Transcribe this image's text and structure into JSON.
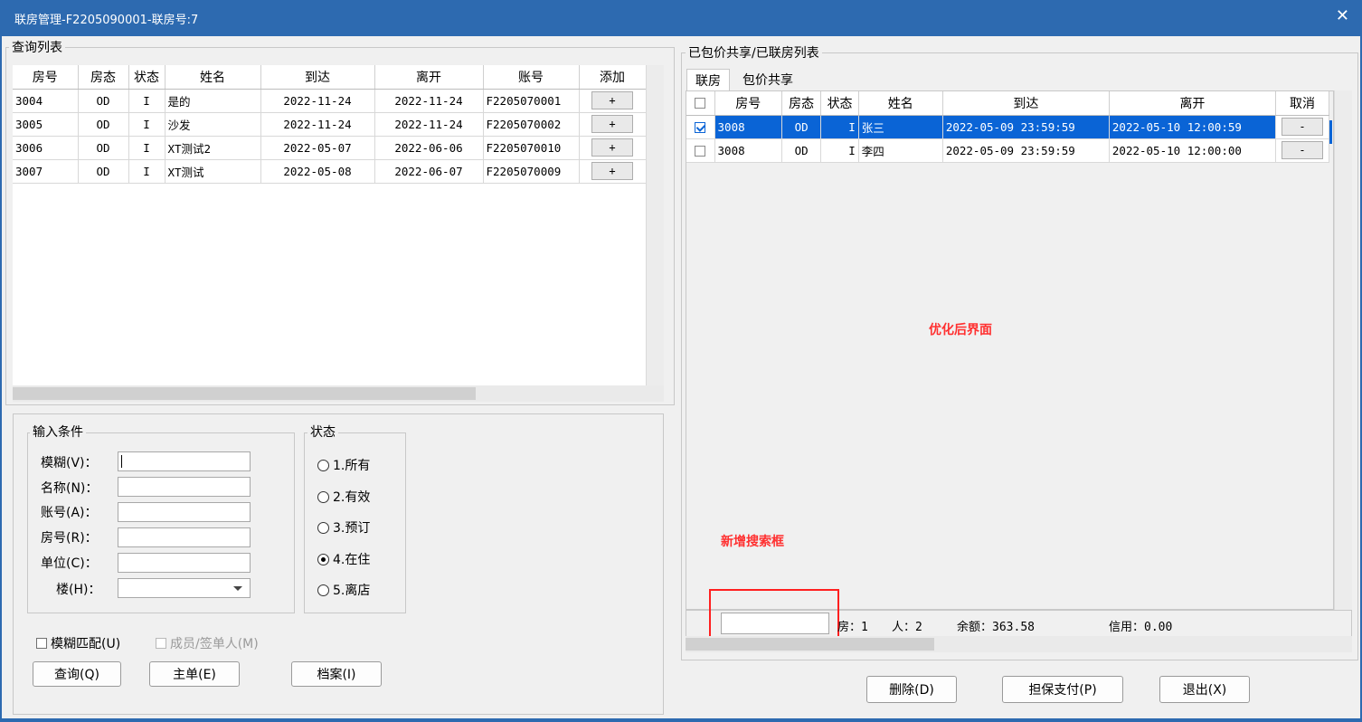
{
  "window": {
    "title": "联房管理-F2205090001-联房号:7",
    "close": "✕"
  },
  "left": {
    "group_title": "查询列表",
    "columns": [
      "房号",
      "房态",
      "状态",
      "姓名",
      "到达",
      "离开",
      "账号",
      "添加"
    ],
    "rows": [
      {
        "room": "3004",
        "room_state": "OD",
        "status": "I",
        "name": "是的",
        "arrive": "2022-11-24",
        "depart": "2022-11-24",
        "account": "F2205070001",
        "add": "+"
      },
      {
        "room": "3005",
        "room_state": "OD",
        "status": "I",
        "name": "沙发",
        "arrive": "2022-11-24",
        "depart": "2022-11-24",
        "account": "F2205070002",
        "add": "+"
      },
      {
        "room": "3006",
        "room_state": "OD",
        "status": "I",
        "name": "XT测试2",
        "arrive": "2022-05-07",
        "depart": "2022-06-06",
        "account": "F2205070010",
        "add": "+"
      },
      {
        "room": "3007",
        "room_state": "OD",
        "status": "I",
        "name": "XT测试",
        "arrive": "2022-05-08",
        "depart": "2022-06-07",
        "account": "F2205070009",
        "add": "+"
      }
    ]
  },
  "conditions": {
    "group_title": "输入条件",
    "fuzzy_label": "模糊(V)：",
    "name_label": "名称(N)：",
    "account_label": "账号(A)：",
    "room_label": "房号(R)：",
    "unit_label": "单位(C)：",
    "building_label": "楼(H)："
  },
  "status_group": {
    "title": "状态",
    "options": [
      "1.所有",
      "2.有效",
      "3.预订",
      "4.在住",
      "5.离店"
    ],
    "selected_index": 3
  },
  "checks": {
    "fuzzy_match": "模糊匹配(U)",
    "member": "成员/签单人(M)"
  },
  "left_buttons": {
    "query": "查询(Q)",
    "master": "主单(E)",
    "profile": "档案(I)"
  },
  "right": {
    "group_title": "已包价共享/已联房列表",
    "tabs": [
      "联房",
      "包价共享"
    ],
    "columns": [
      "房号",
      "房态",
      "状态",
      "姓名",
      "到达",
      "离开",
      "取消"
    ],
    "rows": [
      {
        "checked": true,
        "room": "3008",
        "room_state": "OD",
        "status": "I",
        "name": "张三",
        "arrive": "2022-05-09 23:59:59",
        "depart": "2022-05-10 12:00:59",
        "cancel": "-"
      },
      {
        "checked": false,
        "room": "3008",
        "room_state": "OD",
        "status": "I",
        "name": "李四",
        "arrive": "2022-05-09 23:59:59",
        "depart": "2022-05-10 12:00:00",
        "cancel": "-"
      }
    ],
    "annotation_main": "优化后界面",
    "annotation_search": "新增搜索框",
    "stats": {
      "rooms_label": "房：",
      "rooms": "1",
      "people_label": "人：",
      "people": "2",
      "balance_label": "余额：",
      "balance": "363.58",
      "credit_label": "信用：",
      "credit": "0.00"
    }
  },
  "right_buttons": {
    "delete": "删除(D)",
    "guarantee": "担保支付(P)",
    "exit": "退出(X)"
  },
  "colors": {
    "title_bar": "#2d6ab0",
    "selection": "#0a64d6",
    "annotation": "#ff3030"
  }
}
